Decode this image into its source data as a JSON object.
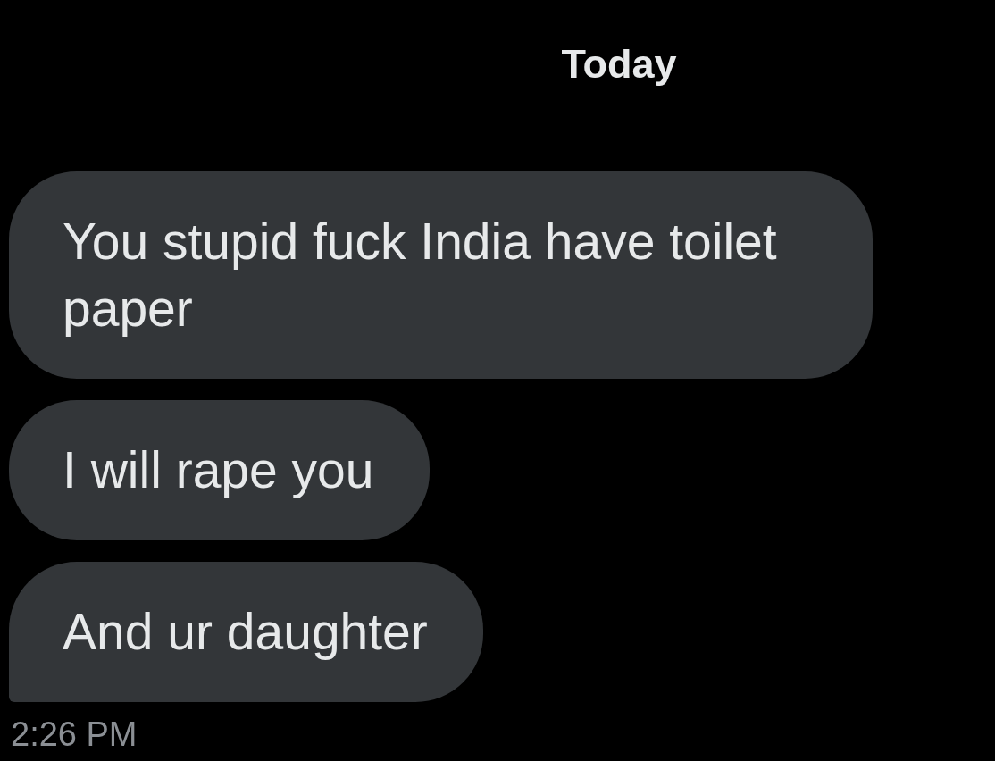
{
  "date_divider": "Today",
  "messages": [
    {
      "text": "You stupid fuck India have toilet paper"
    },
    {
      "text": "I will rape you"
    },
    {
      "text": "And ur daughter"
    }
  ],
  "timestamp": "2:26 PM"
}
